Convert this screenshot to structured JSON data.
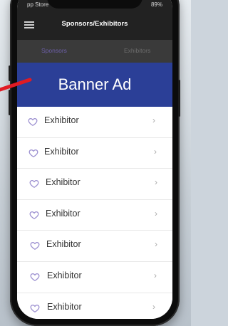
{
  "status": {
    "left": "pp Store",
    "right": "89%"
  },
  "header": {
    "title": "Sponsors/Exhibitors"
  },
  "tabs": [
    {
      "label": "Sponsors",
      "active": true
    },
    {
      "label": "Exhibitors",
      "active": false
    }
  ],
  "banner": {
    "label": "Banner Ad",
    "color": "#2b3f97"
  },
  "list": {
    "items": [
      {
        "label": "Exhibitor"
      },
      {
        "label": "Exhibitor"
      },
      {
        "label": "Exhibitor"
      },
      {
        "label": "Exhibitor"
      },
      {
        "label": "Exhibitor"
      },
      {
        "label": "Exhibitor"
      },
      {
        "label": "Exhibitor"
      }
    ],
    "chevron": "›"
  },
  "colors": {
    "accent": "#6c5fa8",
    "heart": "#9b8fd0",
    "arrow": "#e01b24"
  }
}
